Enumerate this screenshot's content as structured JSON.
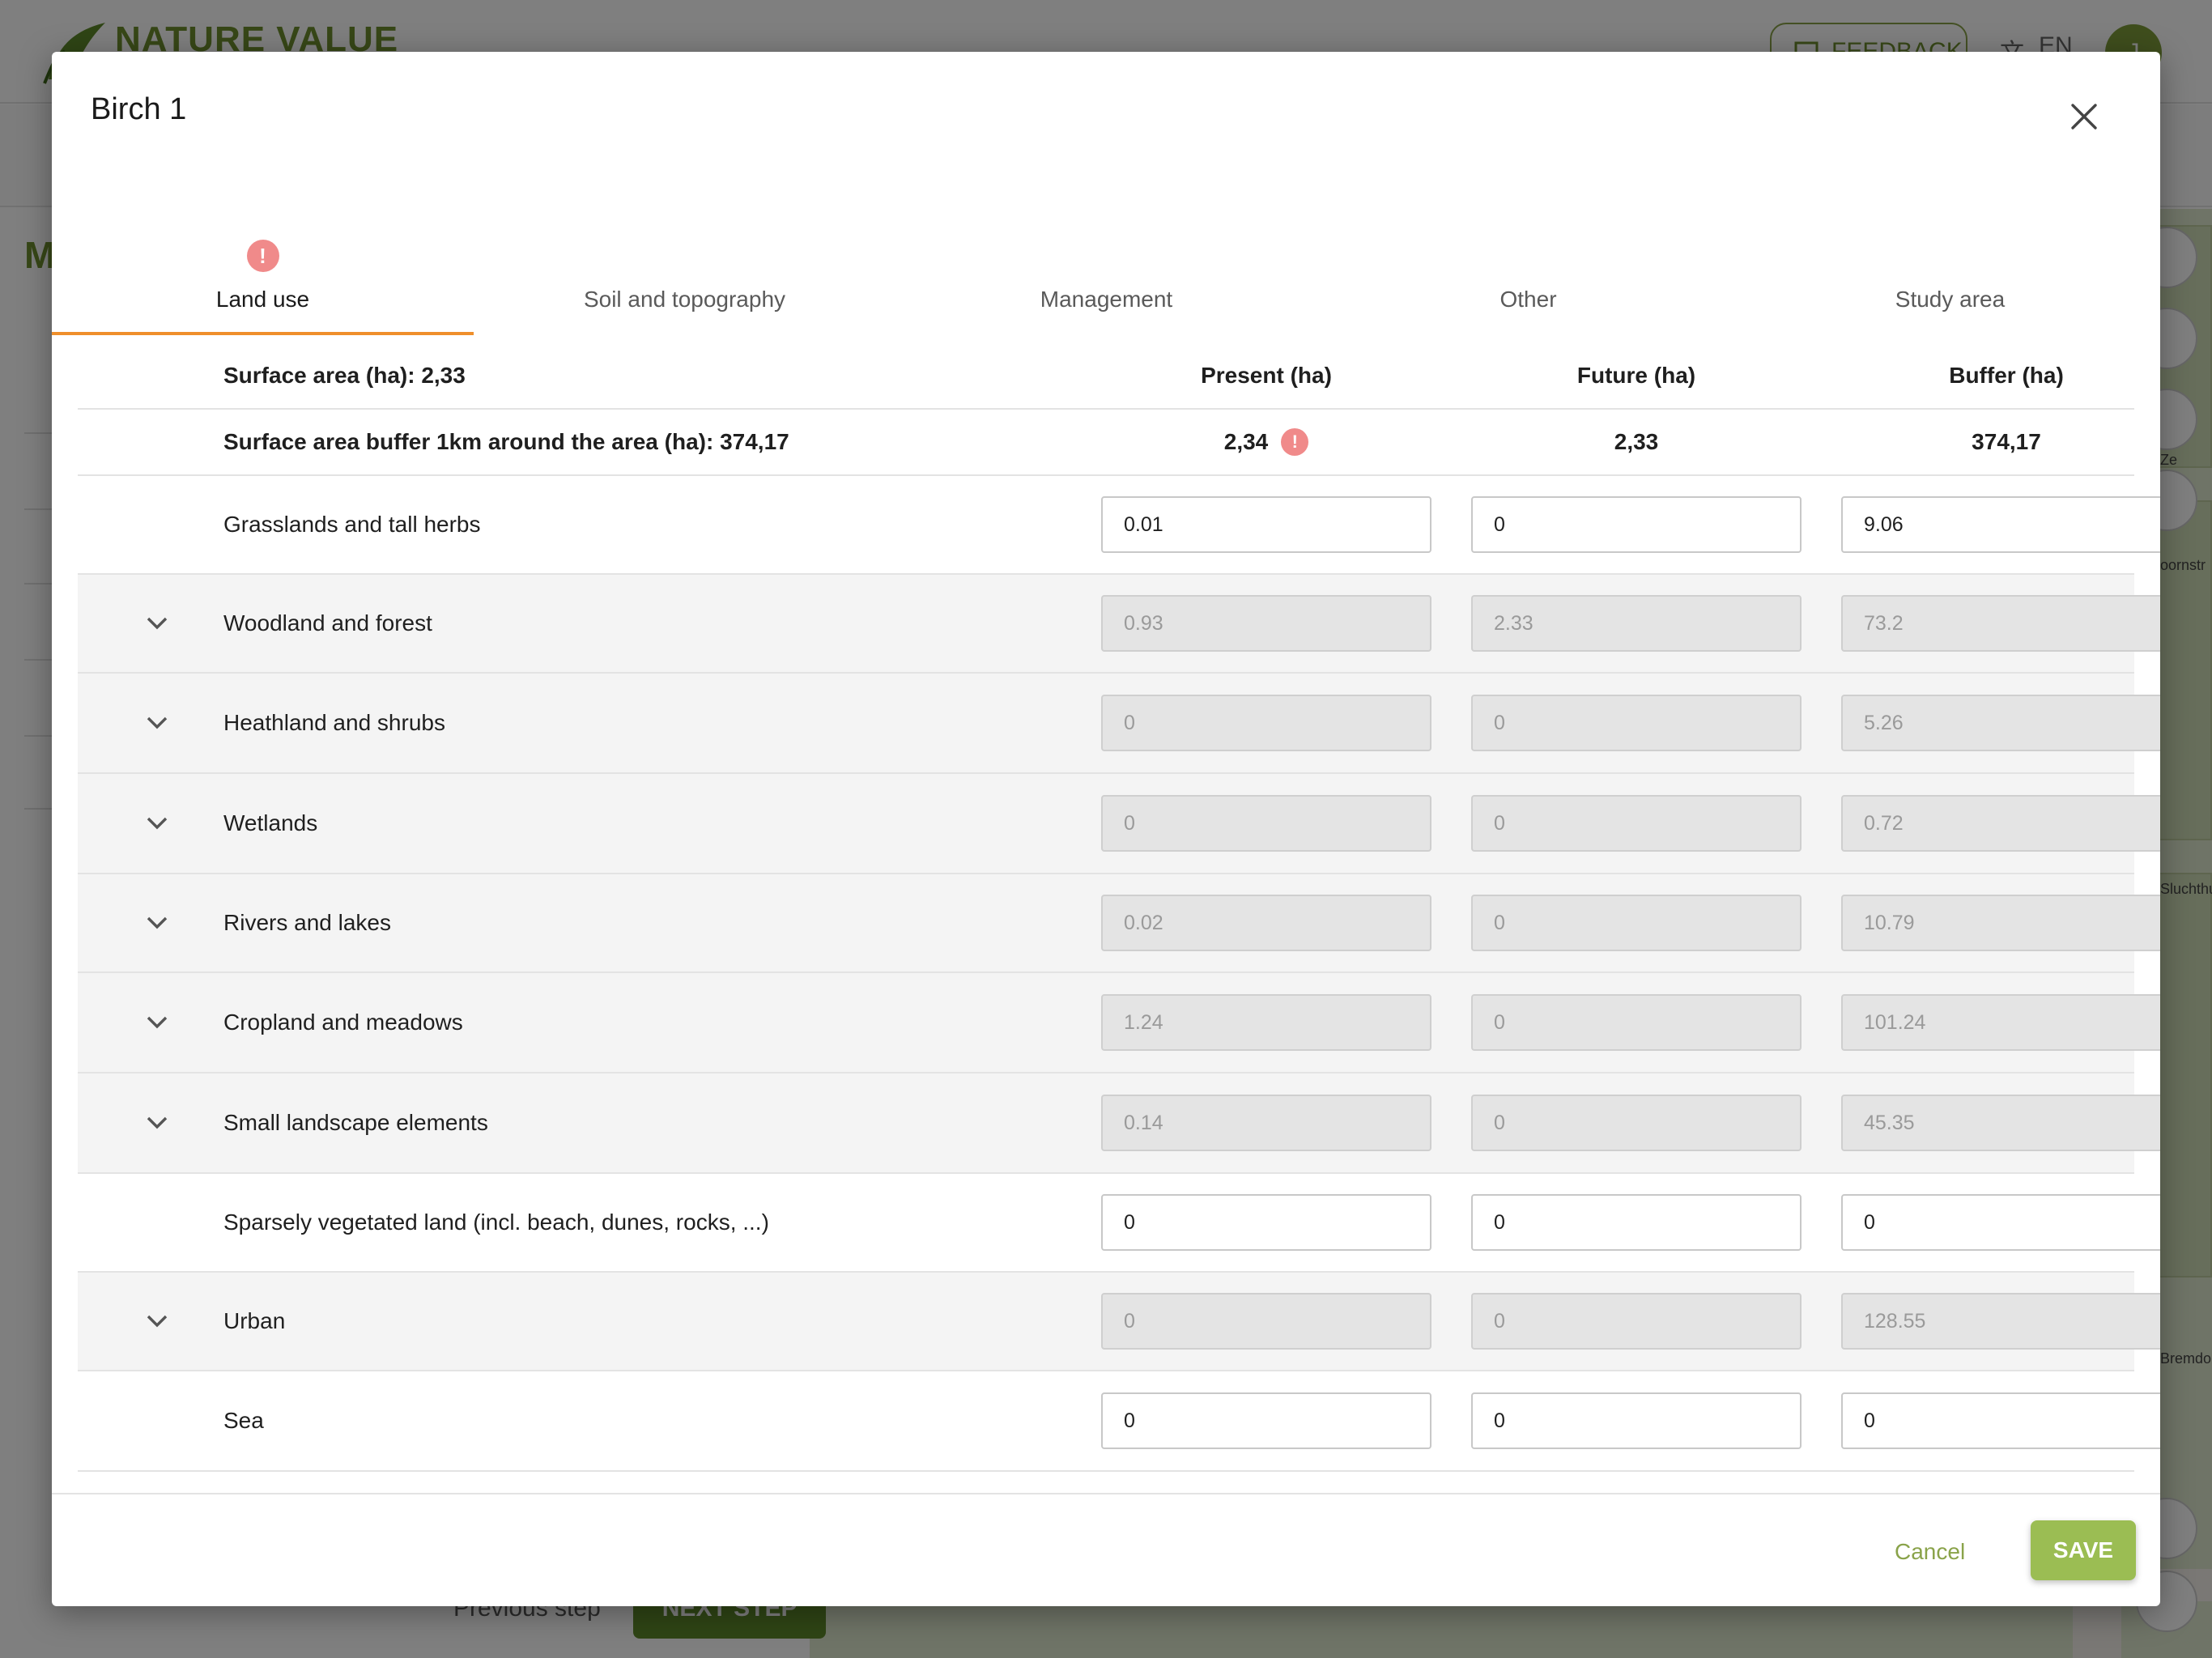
{
  "app": {
    "logo_text": "NATURE VALUE",
    "feedback_label": "FEEDBACK",
    "language": "EN",
    "user_initial": "J",
    "left_heading": "M",
    "previous_step": "Previous step",
    "next_step": "NEXT STEP"
  },
  "modal": {
    "title": "Birch 1",
    "close_icon": "close-icon"
  },
  "tabs": [
    {
      "label": "Land use",
      "active": true,
      "warning": true
    },
    {
      "label": "Soil and topography",
      "active": false,
      "warning": false
    },
    {
      "label": "Management",
      "active": false,
      "warning": false
    },
    {
      "label": "Other",
      "active": false,
      "warning": false
    },
    {
      "label": "Study area",
      "active": false,
      "warning": false
    }
  ],
  "table": {
    "surface_area": "Surface area (ha): 2,33",
    "headers": {
      "present": "Present (ha)",
      "future": "Future (ha)",
      "buffer": "Buffer (ha)"
    },
    "buffer_area": "Surface area buffer 1km around the area (ha): 374,17",
    "totals": {
      "present": "2,34",
      "future": "2,33",
      "buffer": "374,17"
    },
    "rows": [
      {
        "label": "Grasslands and tall herbs",
        "expandable": false,
        "present": "0.01",
        "future": "0",
        "buffer": "9.06"
      },
      {
        "label": "Woodland and forest",
        "expandable": true,
        "present": "0.93",
        "future": "2.33",
        "buffer": "73.2"
      },
      {
        "label": "Heathland and shrubs",
        "expandable": true,
        "present": "0",
        "future": "0",
        "buffer": "5.26"
      },
      {
        "label": "Wetlands",
        "expandable": true,
        "present": "0",
        "future": "0",
        "buffer": "0.72"
      },
      {
        "label": "Rivers and lakes",
        "expandable": true,
        "present": "0.02",
        "future": "0",
        "buffer": "10.79"
      },
      {
        "label": "Cropland and meadows",
        "expandable": true,
        "present": "1.24",
        "future": "0",
        "buffer": "101.24"
      },
      {
        "label": "Small landscape elements",
        "expandable": true,
        "present": "0.14",
        "future": "0",
        "buffer": "45.35"
      },
      {
        "label": "Sparsely vegetated land (incl. beach, dunes, rocks, ...)",
        "expandable": false,
        "present": "0",
        "future": "0",
        "buffer": "0"
      },
      {
        "label": "Urban",
        "expandable": true,
        "present": "0",
        "future": "0",
        "buffer": "128.55"
      },
      {
        "label": "Sea",
        "expandable": false,
        "present": "0",
        "future": "0",
        "buffer": "0"
      }
    ]
  },
  "footer": {
    "cancel_label": "Cancel",
    "save_label": "SAVE"
  },
  "colors": {
    "accent_orange": "#ef8f2b",
    "brand_green": "#9bbd53",
    "warning_red": "#f08a8a"
  },
  "map_labels": [
    "Ze",
    "oornstr",
    "Sluchthuisstr",
    "Bremdo"
  ]
}
